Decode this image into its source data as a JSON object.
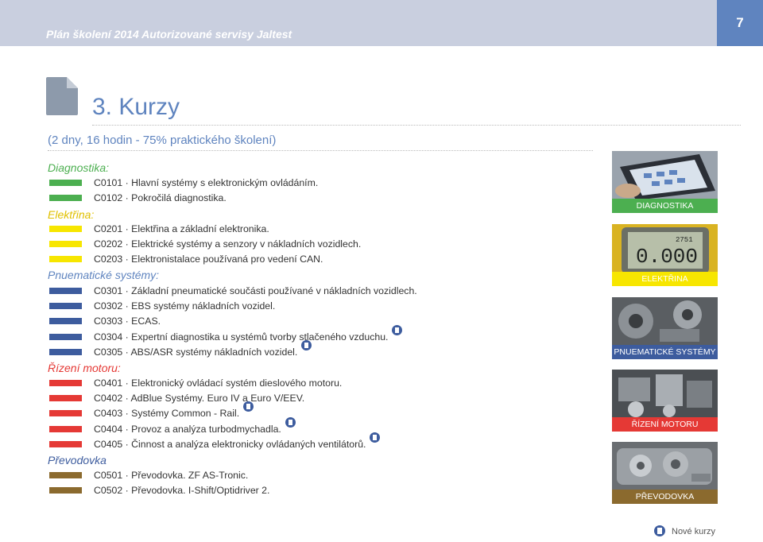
{
  "header": {
    "title": "Plán školení 2014 Autorizované servisy Jaltest",
    "page_number": "7"
  },
  "section_title": "3. Kurzy",
  "subtitle": "(2 dny, 16 hodin - 75% praktického školení)",
  "categories": [
    {
      "name": "Diagnostika:",
      "color": "#4caf50"
    },
    {
      "name": "Elektřina:",
      "color": "#f7e600"
    },
    {
      "name": "Pnuematické systémy:",
      "color": "#3d5c9e"
    },
    {
      "name": "Řízení motoru:",
      "color": "#e53935"
    },
    {
      "name": "Převodovka",
      "color": "#8b6a2e"
    }
  ],
  "courses": [
    {
      "text": "C0101 · Hlavní systémy s elektronickým ovládáním.",
      "new": false
    },
    {
      "text": "C0102 · Pokročilá diagnostika.",
      "new": false
    },
    {
      "text": "C0201 · Elektřina a základní elektronika.",
      "new": false
    },
    {
      "text": "C0202 · Elektrické systémy a senzory v nákladních vozidlech.",
      "new": false
    },
    {
      "text": "C0203 · Elektronistalace používaná pro vedení CAN.",
      "new": false
    },
    {
      "text": "C0301 · Základní pneumatické součásti používané v nákladních vozidlech.",
      "new": false
    },
    {
      "text": "C0302 · EBS systémy nákladních vozidel.",
      "new": false
    },
    {
      "text": "C0303 · ECAS.",
      "new": false
    },
    {
      "text": "C0304 · Expertní diagnostika u systémů tvorby stlačeného vzduchu.",
      "new": true
    },
    {
      "text": "C0305 · ABS/ASR systémy nákladních vozidel.",
      "new": true
    },
    {
      "text": "C0401 · Elektronický ovládací systém dieslového motoru.",
      "new": false
    },
    {
      "text": "C0402 · AdBlue Systémy. Euro IV a Euro V/EEV.",
      "new": false
    },
    {
      "text": "C0403 · Systémy Common - Rail.",
      "new": true
    },
    {
      "text": "C0404 · Provoz a analýza turbodmychadla.",
      "new": true
    },
    {
      "text": "C0405 · Činnost a analýza elektronicky ovládaných ventilátorů.",
      "new": true
    },
    {
      "text": "C0501 · Převodovka. ZF AS-Tronic.",
      "new": false
    },
    {
      "text": "C0502 · Převodovka. I-Shift/Optidriver 2.",
      "new": false
    }
  ],
  "photos": [
    {
      "label": "DIAGNOSTIKA",
      "color": "#4caf50"
    },
    {
      "label": "ELEKTŘINA",
      "color": "#f7e600"
    },
    {
      "label": "PNUEMATICKÉ SYSTÉMY",
      "color": "#3d5c9e"
    },
    {
      "label": "ŘÍZENÍ MOTORU",
      "color": "#e53935"
    },
    {
      "label": "PŘEVODOVKA",
      "color": "#8b6a2e"
    }
  ],
  "legend": {
    "label": "Nové kurzy"
  }
}
